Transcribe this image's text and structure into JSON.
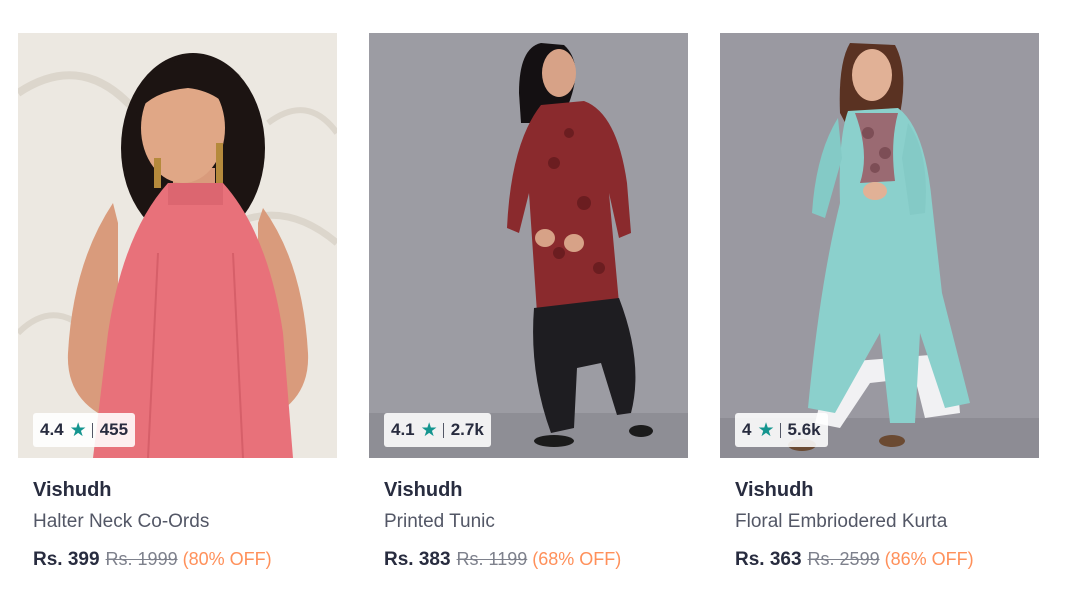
{
  "products": [
    {
      "image_alt": "Woman in pink halter neck top",
      "rating": "4.4",
      "rating_count": "455",
      "brand": "Vishudh",
      "name": "Halter Neck Co-Ords",
      "price": "Rs. 399",
      "mrp": "Rs. 1999",
      "discount": "(80% OFF)"
    },
    {
      "image_alt": "Woman in maroon printed tunic with black dhoti pants",
      "rating": "4.1",
      "rating_count": "2.7k",
      "brand": "Vishudh",
      "name": "Printed Tunic",
      "price": "Rs. 383",
      "mrp": "Rs. 1199",
      "discount": "(68% OFF)"
    },
    {
      "image_alt": "Woman in sea green floral embroidered kurta",
      "rating": "4",
      "rating_count": "5.6k",
      "brand": "Vishudh",
      "name": "Floral Embriodered Kurta",
      "price": "Rs. 363",
      "mrp": "Rs. 2599",
      "discount": "(86% OFF)"
    }
  ],
  "icons": {
    "rating_star": "star-icon"
  },
  "colors": {
    "star": "#14958f",
    "discount": "#ff905a",
    "brand_text": "#282c3f",
    "muted_text": "#535766"
  }
}
